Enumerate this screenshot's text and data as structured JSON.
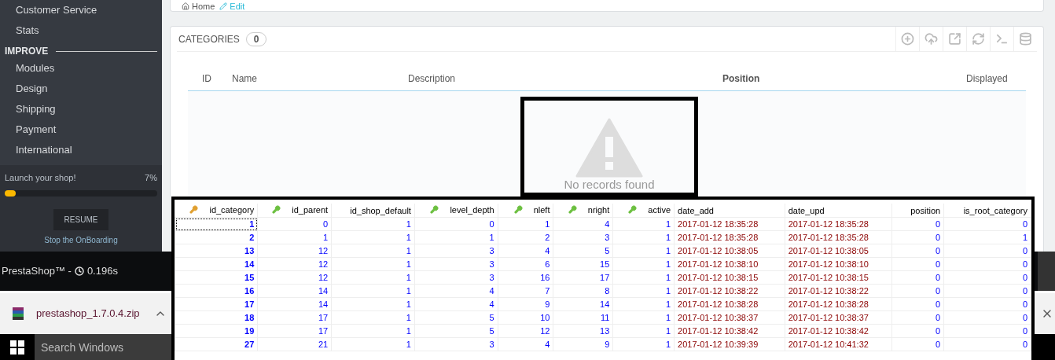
{
  "sidebar": {
    "items": [
      {
        "kind": "link",
        "label": "Customer Service"
      },
      {
        "kind": "link",
        "label": "Stats"
      },
      {
        "kind": "heading",
        "label": "IMPROVE"
      },
      {
        "kind": "link",
        "label": "Modules"
      },
      {
        "kind": "link",
        "label": "Design"
      },
      {
        "kind": "link",
        "label": "Shipping"
      },
      {
        "kind": "link",
        "label": "Payment"
      },
      {
        "kind": "link",
        "label": "International"
      }
    ],
    "onboarding": {
      "title": "Launch your shop!",
      "percent": "7%",
      "level": 0.07,
      "button": "RESUME",
      "stop_link": "Stop the OnBoarding"
    }
  },
  "footer": {
    "brand": "PrestaShop™ -",
    "time": "0.196s"
  },
  "download_bar": {
    "file": "prestashop_1.7.0.4.zip"
  },
  "taskbar": {
    "search": "Search Windows"
  },
  "breadcrumb": [
    {
      "label": "Home"
    },
    {
      "label": "Edit"
    }
  ],
  "panel": {
    "title": "CATEGORIES",
    "count": "0",
    "columns": [
      {
        "label": "ID",
        "bold": false
      },
      {
        "label": "Name",
        "bold": false
      },
      {
        "label": "Description",
        "bold": false
      },
      {
        "label": "Position",
        "bold": true
      },
      {
        "label": "Displayed",
        "bold": false
      }
    ],
    "empty": "No records found"
  },
  "db_table": {
    "columns": [
      {
        "name": "id_category",
        "kind": "primary"
      },
      {
        "name": "id_parent",
        "kind": "foreign"
      },
      {
        "name": "id_shop_default",
        "kind": "plain"
      },
      {
        "name": "level_depth",
        "kind": "foreign"
      },
      {
        "name": "nleft",
        "kind": "foreign"
      },
      {
        "name": "nright",
        "kind": "foreign"
      },
      {
        "name": "active",
        "kind": "foreign"
      },
      {
        "name": "date_add",
        "kind": "date"
      },
      {
        "name": "date_upd",
        "kind": "date"
      },
      {
        "name": "position",
        "kind": "plain"
      },
      {
        "name": "is_root_category",
        "kind": "plain"
      }
    ],
    "rows": [
      {
        "focused": true,
        "cells": [
          "1",
          "0",
          "1",
          "0",
          "1",
          "4",
          "1",
          "2017-01-12 18:35:28",
          "2017-01-12 18:35:28",
          "0",
          "0"
        ]
      },
      {
        "focused": false,
        "cells": [
          "2",
          "1",
          "1",
          "1",
          "2",
          "3",
          "1",
          "2017-01-12 18:35:28",
          "2017-01-12 18:35:28",
          "0",
          "1"
        ]
      },
      {
        "focused": false,
        "cells": [
          "13",
          "12",
          "1",
          "3",
          "4",
          "5",
          "1",
          "2017-01-12 10:38:05",
          "2017-01-12 10:38:05",
          "0",
          "0"
        ]
      },
      {
        "focused": false,
        "cells": [
          "14",
          "12",
          "1",
          "3",
          "6",
          "15",
          "1",
          "2017-01-12 10:38:10",
          "2017-01-12 10:38:10",
          "0",
          "0"
        ]
      },
      {
        "focused": false,
        "cells": [
          "15",
          "12",
          "1",
          "3",
          "16",
          "17",
          "1",
          "2017-01-12 10:38:15",
          "2017-01-12 10:38:15",
          "0",
          "0"
        ]
      },
      {
        "focused": false,
        "cells": [
          "16",
          "14",
          "1",
          "4",
          "7",
          "8",
          "1",
          "2017-01-12 10:38:22",
          "2017-01-12 10:38:22",
          "0",
          "0"
        ]
      },
      {
        "focused": false,
        "cells": [
          "17",
          "14",
          "1",
          "4",
          "9",
          "14",
          "1",
          "2017-01-12 10:38:28",
          "2017-01-12 10:38:28",
          "0",
          "0"
        ]
      },
      {
        "focused": false,
        "cells": [
          "18",
          "17",
          "1",
          "5",
          "10",
          "11",
          "1",
          "2017-01-12 10:38:37",
          "2017-01-12 10:38:37",
          "0",
          "0"
        ]
      },
      {
        "focused": false,
        "cells": [
          "19",
          "17",
          "1",
          "5",
          "12",
          "13",
          "1",
          "2017-01-12 10:38:42",
          "2017-01-12 10:38:42",
          "0",
          "0"
        ]
      },
      {
        "focused": false,
        "cells": [
          "27",
          "21",
          "1",
          "3",
          "4",
          "9",
          "1",
          "2017-01-12 10:39:39",
          "2017-01-12 10:41:32",
          "0",
          "0"
        ]
      }
    ]
  }
}
